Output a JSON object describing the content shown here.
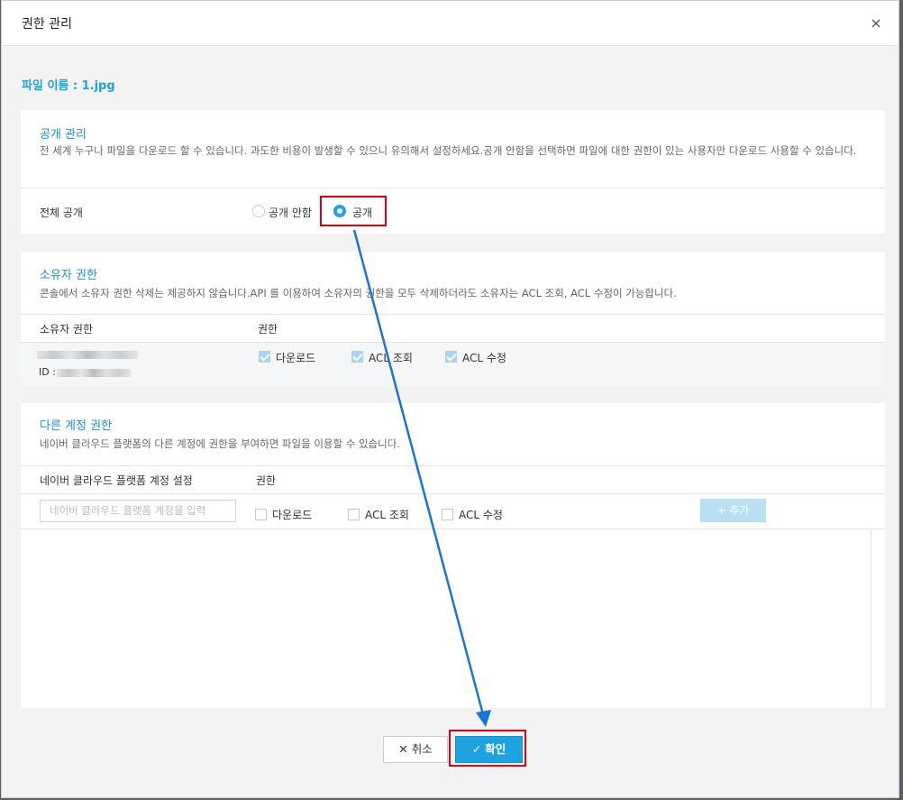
{
  "modal": {
    "title": "권한 관리"
  },
  "file": {
    "label": "파일 이름 : 1.jpg"
  },
  "public_section": {
    "title": "공개 관리",
    "description": "전 세계 누구나 파일을 다운로드 할 수 있습니다. 과도한 비용이 발생할 수 있으니 유의해서 설정하세요.공개 안함을 선택하면 파일에 대한 권한이 있는 사용자만 다운로드 사용할 수 있습니다.",
    "row_label": "전체 공개",
    "options": [
      {
        "label": "공개 안함",
        "selected": false
      },
      {
        "label": "공개",
        "selected": true
      }
    ]
  },
  "owner_section": {
    "title": "소유자 권한",
    "description": "콘솔에서 소유자 권한 삭제는 제공하지 않습니다.API 를 이용하여 소유자의 권한을 모두 삭제하더라도 소유자는 ACL 조회, ACL 수정이 가능합니다.",
    "col_owner": "소유자 권한",
    "col_perm": "권한",
    "id_prefix": "ID :",
    "permissions": [
      {
        "label": "다운로드",
        "checked": true
      },
      {
        "label": "ACL 조회",
        "checked": true
      },
      {
        "label": "ACL 수정",
        "checked": true
      }
    ]
  },
  "other_section": {
    "title": "다른 계정 권한",
    "description": "네이버 클라우드 플랫폼의 다른 계정에 권한을 부여하면 파일을 이용할 수 있습니다.",
    "col_account": "네이버 클라우드 플랫폼 계정 설정",
    "col_perm": "권한",
    "input_placeholder": "네이버 클라우드 플랫폼 계정을 입력",
    "permissions": [
      {
        "label": "다운로드",
        "checked": false
      },
      {
        "label": "ACL 조회",
        "checked": false
      },
      {
        "label": "ACL 수정",
        "checked": false
      }
    ],
    "add_label": "+ 추가"
  },
  "footer": {
    "cancel_label": "취소",
    "ok_label": "확인"
  },
  "colors": {
    "accent": "#1ea2e0",
    "highlight": "#e2000f",
    "arrow": "#1a73d9"
  }
}
